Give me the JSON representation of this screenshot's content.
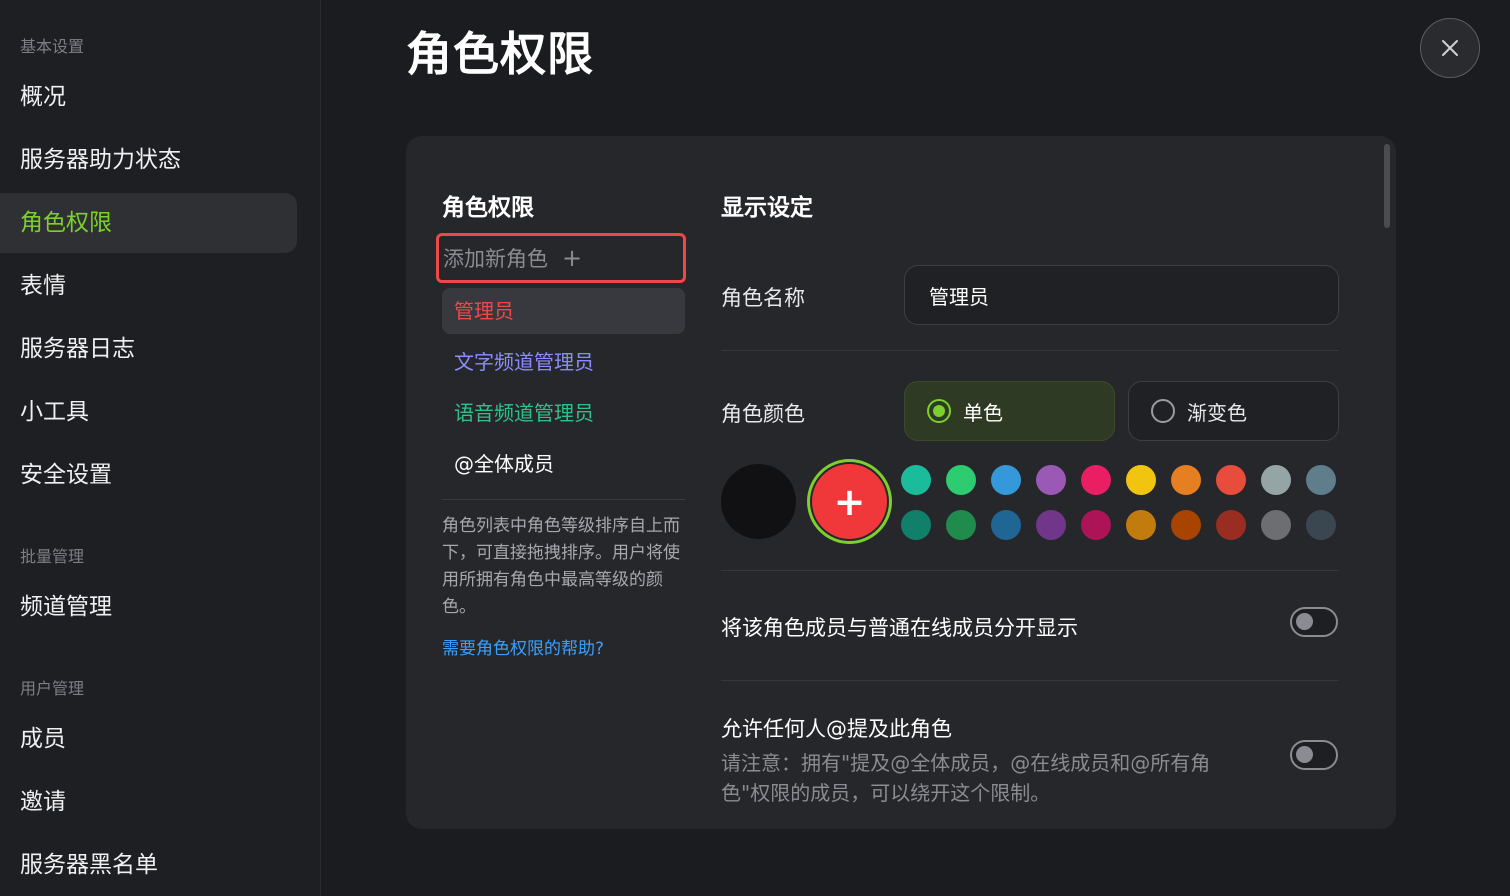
{
  "page_title": "角色权限",
  "sidebar": {
    "groups": [
      {
        "label": "基本设置",
        "items": [
          "概况",
          "服务器助力状态",
          "角色权限",
          "表情",
          "服务器日志",
          "小工具",
          "安全设置"
        ]
      },
      {
        "label": "批量管理",
        "items": [
          "频道管理"
        ]
      },
      {
        "label": "用户管理",
        "items": [
          "成员",
          "邀请",
          "服务器黑名单"
        ]
      }
    ],
    "active_item": "角色权限"
  },
  "roles_column": {
    "title": "角色权限",
    "add_role_label": "添加新角色",
    "add_role_icon": "plus-icon",
    "roles": [
      {
        "name": "管理员",
        "color": "#f0484a",
        "selected": true
      },
      {
        "name": "文字频道管理员",
        "color": "#8c8cff",
        "selected": false
      },
      {
        "name": "语音频道管理员",
        "color": "#2ec28a",
        "selected": false
      },
      {
        "name": "@全体成员",
        "color": "#ffffff",
        "selected": false
      }
    ],
    "description": "角色列表中角色等级排序自上而下，可直接拖拽排序。用户将使用所拥有角色中最高等级的颜色。",
    "help_link": "需要角色权限的帮助?"
  },
  "display_settings": {
    "title": "显示设定",
    "role_name_label": "角色名称",
    "role_name_value": "管理员",
    "role_color_label": "角色颜色",
    "color_mode_solid": "单色",
    "color_mode_gradient": "渐变色",
    "selected_color_mode": "单色",
    "current_color": "#111113",
    "accent_color": "#7ccf2c",
    "palette_row1": [
      "#1abc9c",
      "#2ecc71",
      "#3498db",
      "#9b59b6",
      "#e91e63",
      "#f1c40f",
      "#e67e22",
      "#e74c3c",
      "#95a5a6",
      "#607d8b"
    ],
    "palette_row2": [
      "#11806a",
      "#1f8b4c",
      "#206694",
      "#71368a",
      "#ad1457",
      "#c27c0e",
      "#a84300",
      "#992d22",
      "#6c6e72",
      "#3a4750"
    ],
    "separate_display_label": "将该角色成员与普通在线成员分开显示",
    "separate_display_on": false,
    "mentionable_label": "允许任何人@提及此角色",
    "mentionable_note": "请注意：拥有\"提及@全体成员，@在线成员和@所有角色\"权限的成员，可以绕开这个限制。",
    "mentionable_on": false
  },
  "close_icon": "close-icon"
}
